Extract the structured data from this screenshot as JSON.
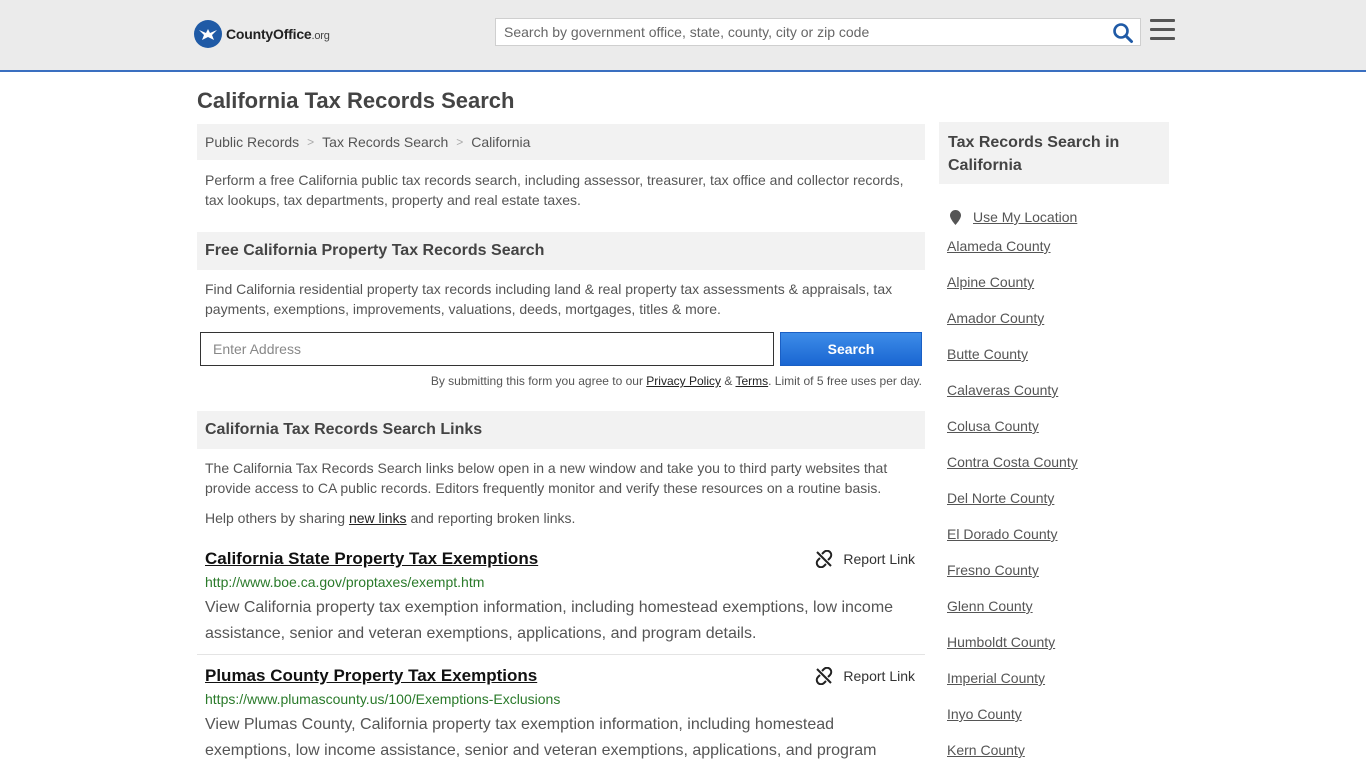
{
  "header": {
    "logo_main": "CountyOffice",
    "logo_suffix": ".org",
    "search_placeholder": "Search by government office, state, county, city or zip code"
  },
  "page": {
    "title": "California Tax Records Search",
    "intro": "Perform a free California public tax records search, including assessor, treasurer, tax office and collector records, tax lookups, tax departments, property and real estate taxes."
  },
  "breadcrumb": [
    "Public Records",
    "Tax Records Search",
    "California"
  ],
  "property_search": {
    "heading": "Free California Property Tax Records Search",
    "description": "Find California residential property tax records including land & real property tax assessments & appraisals, tax payments, exemptions, improvements, valuations, deeds, mortgages, titles & more.",
    "address_placeholder": "Enter Address",
    "button_label": "Search",
    "disclaimer_prefix": "By submitting this form you agree to our",
    "privacy_label": "Privacy Policy",
    "amp": "&",
    "terms_label": "Terms",
    "disclaimer_suffix": ". Limit of 5 free uses per day."
  },
  "links_section": {
    "heading": "California Tax Records Search Links",
    "description": "The California Tax Records Search links below open in a new window and take you to third party websites that provide access to CA public records. Editors frequently monitor and verify these resources on a routine basis.",
    "help_prefix": "Help others by sharing",
    "help_link": "new links",
    "help_suffix": "and reporting broken links."
  },
  "results": [
    {
      "title": "California State Property Tax Exemptions",
      "url": "http://www.boe.ca.gov/proptaxes/exempt.htm",
      "description": "View California property tax exemption information, including homestead exemptions, low income assistance, senior and veteran exemptions, applications, and program details.",
      "report_label": "Report Link"
    },
    {
      "title": "Plumas County Property Tax Exemptions",
      "url": "https://www.plumascounty.us/100/Exemptions-Exclusions",
      "description": "View Plumas County, California property tax exemption information, including homestead exemptions, low income assistance, senior and veteran exemptions, applications, and program",
      "report_label": "Report Link"
    }
  ],
  "sidebar": {
    "heading": "Tax Records Search in California",
    "use_location": "Use My Location",
    "counties": [
      "Alameda County",
      "Alpine County",
      "Amador County",
      "Butte County",
      "Calaveras County",
      "Colusa County",
      "Contra Costa County",
      "Del Norte County",
      "El Dorado County",
      "Fresno County",
      "Glenn County",
      "Humboldt County",
      "Imperial County",
      "Inyo County",
      "Kern County"
    ]
  }
}
